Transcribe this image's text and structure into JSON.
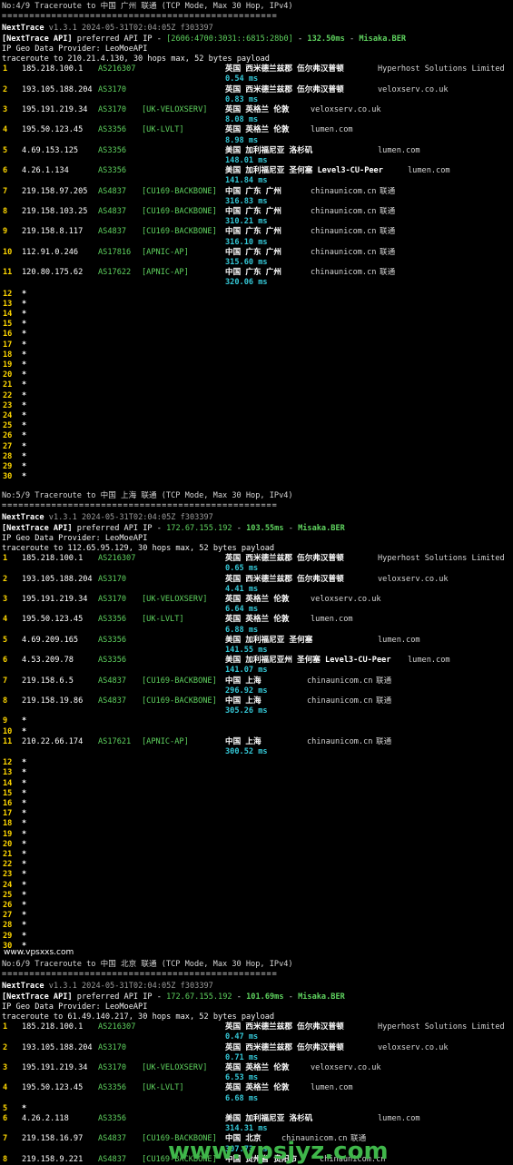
{
  "sections": [
    {
      "header": "No:4/9 Traceroute to 中国 广州 联通 (TCP Mode, Max 30 Hop, IPv4)",
      "separator": "==================================================",
      "app_name": "NextTrace",
      "version": "v1.3.1 2024-05-31T02:04:05Z f303397",
      "api_label": "[NextTrace API]",
      "api_text": "preferred API IP -",
      "api_ip": "[2606:4700:3031::6815:28b0]",
      "api_dash": "-",
      "api_ms": "132.50ms",
      "api_node": "Misaka.BER",
      "geo_provider": "IP Geo Data Provider: LeoMoeAPI",
      "trace_line": "traceroute to 210.21.4.130, 30 hops max, 52 bytes payload",
      "hops": [
        {
          "n": "1",
          "ip": "185.218.100.1",
          "as": "AS216307",
          "tag": "",
          "loc": "英国 西米德兰兹郡 伍尔弗汉普顿",
          "host": "Hyperhost Solutions Limited",
          "isp": "",
          "rtt": "0.54 ms"
        },
        {
          "n": "2",
          "ip": "193.105.188.204",
          "as": "AS3170",
          "tag": "",
          "loc": "英国 西米德兰兹郡 伍尔弗汉普顿",
          "host": "veloxserv.co.uk",
          "isp": "",
          "rtt": "0.83 ms"
        },
        {
          "n": "3",
          "ip": "195.191.219.34",
          "as": "AS3170",
          "tag": "[UK-VELOXSERV]",
          "loc": "英国 英格兰 伦敦",
          "host": "veloxserv.co.uk",
          "isp": "",
          "rtt": "8.08 ms"
        },
        {
          "n": "4",
          "ip": "195.50.123.45",
          "as": "AS3356",
          "tag": "[UK-LVLT]",
          "loc": "英国 英格兰 伦敦",
          "host": "lumen.com",
          "isp": "",
          "rtt": "8.98 ms"
        },
        {
          "n": "5",
          "ip": "4.69.153.125",
          "as": "AS3356",
          "tag": "",
          "loc": "美国 加利福尼亚 洛杉矶",
          "host": "lumen.com",
          "isp": "",
          "rtt": "148.01 ms"
        },
        {
          "n": "6",
          "ip": "4.26.1.134",
          "as": "AS3356",
          "tag": "",
          "loc": "美国 加利福尼亚 圣何塞 Level3-CU-Peer",
          "host": "lumen.com",
          "isp": "",
          "rtt": "141.84 ms"
        },
        {
          "n": "7",
          "ip": "219.158.97.205",
          "as": "AS4837",
          "tag": "[CU169-BACKBONE]",
          "loc": "中国 广东 广州",
          "host": "chinaunicom.cn",
          "isp": "联通",
          "rtt": "316.83 ms"
        },
        {
          "n": "8",
          "ip": "219.158.103.25",
          "as": "AS4837",
          "tag": "[CU169-BACKBONE]",
          "loc": "中国 广东 广州",
          "host": "chinaunicom.cn",
          "isp": "联通",
          "rtt": "310.21 ms"
        },
        {
          "n": "9",
          "ip": "219.158.8.117",
          "as": "AS4837",
          "tag": "[CU169-BACKBONE]",
          "loc": "中国 广东 广州",
          "host": "chinaunicom.cn",
          "isp": "联通",
          "rtt": "316.10 ms"
        },
        {
          "n": "10",
          "ip": "112.91.0.246",
          "as": "AS17816",
          "tag": "[APNIC-AP]",
          "loc": "中国 广东 广州",
          "host": "chinaunicom.cn",
          "isp": "联通",
          "rtt": "315.60 ms"
        },
        {
          "n": "11",
          "ip": "120.80.175.62",
          "as": "AS17622",
          "tag": "[APNIC-AP]",
          "loc": "中国 广东 广州",
          "host": "chinaunicom.cn",
          "isp": "联通",
          "rtt": "320.06 ms"
        }
      ],
      "stars": [
        "12",
        "13",
        "14",
        "15",
        "16",
        "17",
        "18",
        "19",
        "20",
        "21",
        "22",
        "23",
        "24",
        "25",
        "26",
        "27",
        "28",
        "29",
        "30"
      ]
    },
    {
      "header": "No:5/9 Traceroute to 中国 上海 联通 (TCP Mode, Max 30 Hop, IPv4)",
      "separator": "==================================================",
      "app_name": "NextTrace",
      "version": "v1.3.1 2024-05-31T02:04:05Z f303397",
      "api_label": "[NextTrace API]",
      "api_text": "preferred API IP -",
      "api_ip": "172.67.155.192",
      "api_dash": "-",
      "api_ms": "103.55ms",
      "api_node": "Misaka.BER",
      "geo_provider": "IP Geo Data Provider: LeoMoeAPI",
      "trace_line": "traceroute to 112.65.95.129, 30 hops max, 52 bytes payload",
      "hops": [
        {
          "n": "1",
          "ip": "185.218.100.1",
          "as": "AS216307",
          "tag": "",
          "loc": "英国 西米德兰兹郡 伍尔弗汉普顿",
          "host": "Hyperhost Solutions Limited",
          "isp": "",
          "rtt": "0.65 ms"
        },
        {
          "n": "2",
          "ip": "193.105.188.204",
          "as": "AS3170",
          "tag": "",
          "loc": "英国 西米德兰兹郡 伍尔弗汉普顿",
          "host": "veloxserv.co.uk",
          "isp": "",
          "rtt": "4.41 ms"
        },
        {
          "n": "3",
          "ip": "195.191.219.34",
          "as": "AS3170",
          "tag": "[UK-VELOXSERV]",
          "loc": "英国 英格兰 伦敦",
          "host": "veloxserv.co.uk",
          "isp": "",
          "rtt": "6.64 ms"
        },
        {
          "n": "4",
          "ip": "195.50.123.45",
          "as": "AS3356",
          "tag": "[UK-LVLT]",
          "loc": "英国 英格兰 伦敦",
          "host": "lumen.com",
          "isp": "",
          "rtt": "6.88 ms"
        },
        {
          "n": "5",
          "ip": "4.69.209.165",
          "as": "AS3356",
          "tag": "",
          "loc": "美国 加利福尼亚 圣何塞",
          "host": "lumen.com",
          "isp": "",
          "rtt": "141.55 ms"
        },
        {
          "n": "6",
          "ip": "4.53.209.78",
          "as": "AS3356",
          "tag": "",
          "loc": "美国 加利福尼亚州 圣何塞 Level3-CU-Peer",
          "host": "lumen.com",
          "isp": "",
          "rtt": "141.07 ms"
        },
        {
          "n": "7",
          "ip": "219.158.6.5",
          "as": "AS4837",
          "tag": "[CU169-BACKBONE]",
          "loc": "中国 上海",
          "host": "chinaunicom.cn",
          "isp": "联通",
          "rtt": "296.92 ms"
        },
        {
          "n": "8",
          "ip": "219.158.19.86",
          "as": "AS4837",
          "tag": "[CU169-BACKBONE]",
          "loc": "中国 上海",
          "host": "chinaunicom.cn",
          "isp": "联通",
          "rtt": "305.26 ms"
        },
        {
          "n": "9",
          "star": true
        },
        {
          "n": "10",
          "star": true
        },
        {
          "n": "11",
          "ip": "210.22.66.174",
          "as": "AS17621",
          "tag": "[APNIC-AP]",
          "loc": "中国 上海",
          "host": "chinaunicom.cn",
          "isp": "联通",
          "rtt": "300.52 ms"
        }
      ],
      "stars": [
        "12",
        "13",
        "14",
        "15",
        "16",
        "17",
        "18",
        "19",
        "20",
        "21",
        "22",
        "23",
        "24",
        "25",
        "26",
        "27",
        "28",
        "29",
        "30"
      ]
    },
    {
      "header": "No:6/9 Traceroute to 中国 北京 联通 (TCP Mode, Max 30 Hop, IPv4)",
      "separator": "==================================================",
      "app_name": "NextTrace",
      "version": "v1.3.1 2024-05-31T02:04:05Z f303397",
      "api_label": "[NextTrace API]",
      "api_text": "preferred API IP -",
      "api_ip": "172.67.155.192",
      "api_dash": "-",
      "api_ms": "101.69ms",
      "api_node": "Misaka.BER",
      "geo_provider": "IP Geo Data Provider: LeoMoeAPI",
      "trace_line": "traceroute to 61.49.140.217, 30 hops max, 52 bytes payload",
      "hops": [
        {
          "n": "1",
          "ip": "185.218.100.1",
          "as": "AS216307",
          "tag": "",
          "loc": "英国 西米德兰兹郡 伍尔弗汉普顿",
          "host": "Hyperhost Solutions Limited",
          "isp": "",
          "rtt": "0.47 ms"
        },
        {
          "n": "2",
          "ip": "193.105.188.204",
          "as": "AS3170",
          "tag": "",
          "loc": "英国 西米德兰兹郡 伍尔弗汉普顿",
          "host": "veloxserv.co.uk",
          "isp": "",
          "rtt": "0.71 ms"
        },
        {
          "n": "3",
          "ip": "195.191.219.34",
          "as": "AS3170",
          "tag": "[UK-VELOXSERV]",
          "loc": "英国 英格兰 伦敦",
          "host": "veloxserv.co.uk",
          "isp": "",
          "rtt": "6.53 ms"
        },
        {
          "n": "4",
          "ip": "195.50.123.45",
          "as": "AS3356",
          "tag": "[UK-LVLT]",
          "loc": "英国 英格兰 伦敦",
          "host": "lumen.com",
          "isp": "",
          "rtt": "6.68 ms"
        },
        {
          "n": "5",
          "star": true
        },
        {
          "n": "6",
          "ip": "4.26.2.118",
          "as": "AS3356",
          "tag": "",
          "loc": "美国 加利福尼亚 洛杉矶",
          "host": "lumen.com",
          "isp": "",
          "rtt": "314.31 ms"
        },
        {
          "n": "7",
          "ip": "219.158.16.97",
          "as": "AS4837",
          "tag": "[CU169-BACKBONE]",
          "loc": "中国 北京",
          "host": "chinaunicom.cn",
          "isp": "联通",
          "rtt": "307.73 ms"
        },
        {
          "n": "8",
          "ip": "219.158.9.221",
          "as": "AS4837",
          "tag": "[CU169-BACKBONE]",
          "loc": "中国 贵州省 贵阳市",
          "host": "chinaunicom.cn",
          "isp": "",
          "rtt": ""
        }
      ],
      "stars": []
    }
  ],
  "watermarks": {
    "small": "www.vpsxxs.com",
    "big": "www.vpsjyz.com"
  },
  "colors": {
    "background": "#000000",
    "hop_number": "#ffd700",
    "asn": "#5fd35f",
    "rtt": "#35c7d6",
    "watermark_big": "#3fb64a"
  }
}
